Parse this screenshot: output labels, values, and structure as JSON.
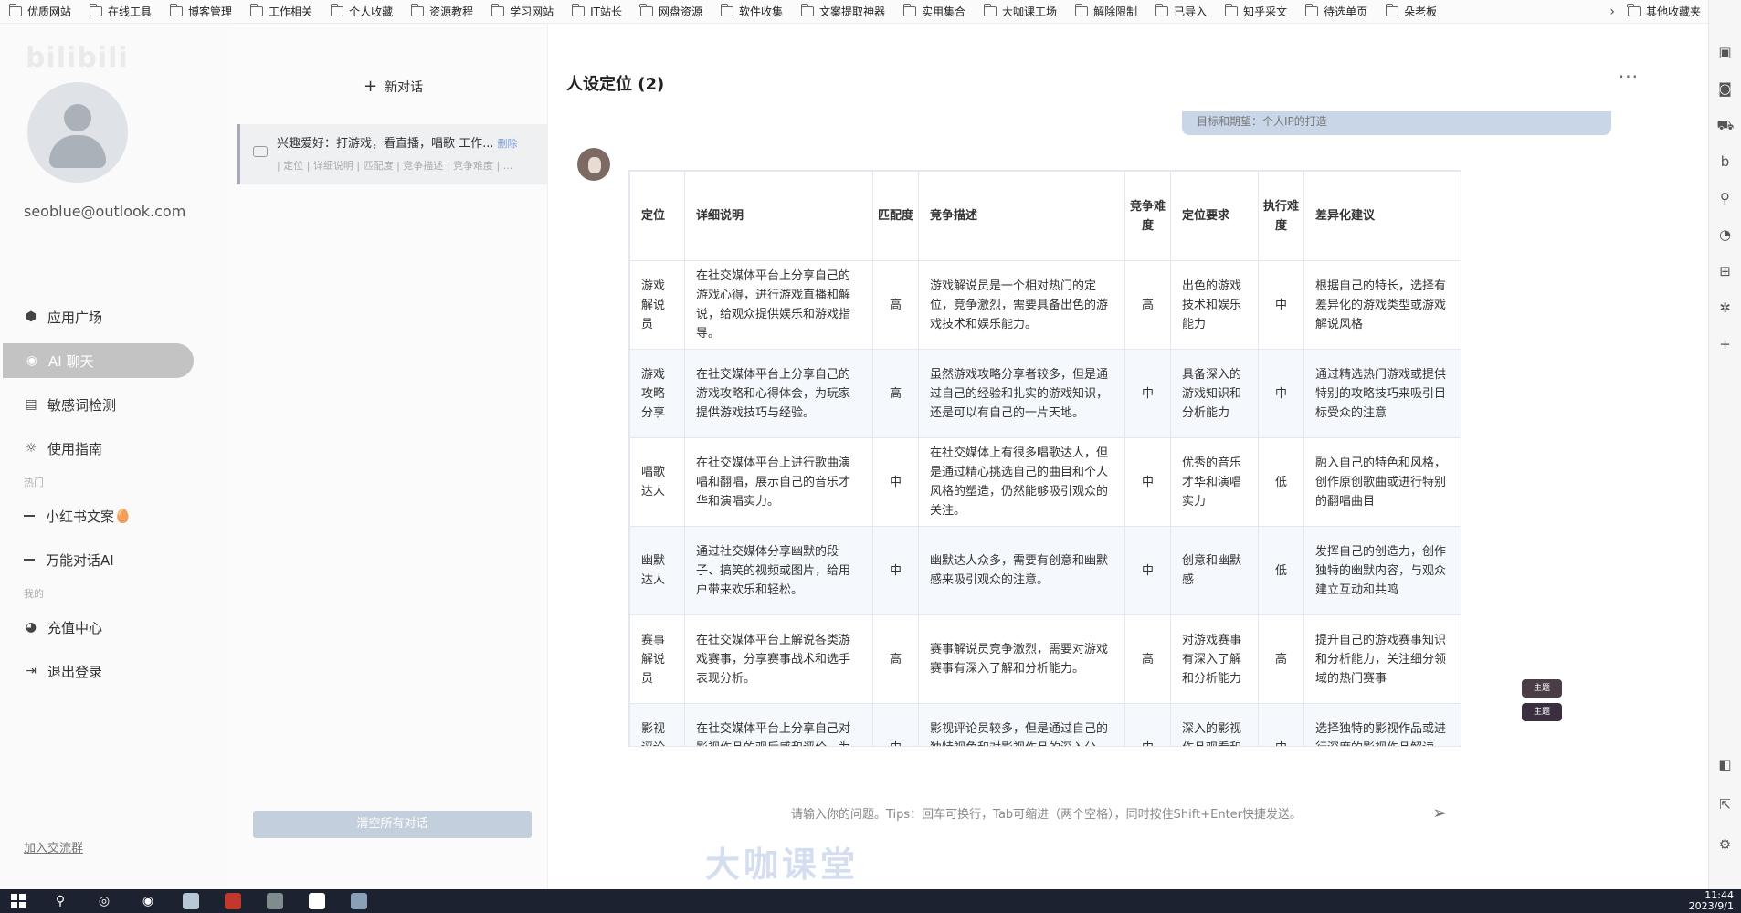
{
  "bookmarks": {
    "items": [
      "优质网站",
      "在线工具",
      "博客管理",
      "工作相关",
      "个人收藏",
      "资源教程",
      "学习网站",
      "IT站长",
      "网盘资源",
      "软件收集",
      "文案提取神器",
      "实用集合",
      "大咖课工场",
      "解除限制",
      "已导入",
      "知乎采文",
      "待选单页",
      "朵老板"
    ],
    "more": "›",
    "other": "其他收藏夹"
  },
  "sidebar": {
    "logo": "bilibili",
    "email": "seoblue@outlook.com",
    "nav": [
      {
        "label": "应用广场",
        "icon": "cube-icon"
      },
      {
        "label": "AI 聊天",
        "icon": "chat-bubble-icon"
      },
      {
        "label": "敏感词检测",
        "icon": "calendar-icon"
      },
      {
        "label": "使用指南",
        "icon": "sun-icon"
      }
    ],
    "section_hot": "热门",
    "hot": [
      {
        "label": "小红书文案",
        "emoji": "🥚"
      },
      {
        "label": "万能对话AI",
        "emoji": ""
      }
    ],
    "section_mine": "我的",
    "mine": [
      {
        "label": "充值中心",
        "icon": "user-circle-icon"
      },
      {
        "label": "退出登录",
        "icon": "logout-icon"
      }
    ],
    "join": "加入交流群"
  },
  "conversations": {
    "new_chat": "新对话",
    "items": [
      {
        "title": "兴趣爱好：打游戏，看直播，唱歌 工作...",
        "delete": "删除",
        "subtitle": "| 定位 | 详细说明 | 匹配度 | 竞争描述 | 竞争难度 | ..."
      }
    ],
    "clear_all": "清空所有对话"
  },
  "main": {
    "title": "人设定位 (2)",
    "more": "···",
    "prev_message": "目标和期望：个人IP的打造",
    "input_hint": "请输入你的问题。Tips：回车可换行，Tab可缩进（两个空格），同时按住Shift+Enter快捷发送。",
    "tag1": "主题",
    "tag2": "主题",
    "watermark": "大咖课堂"
  },
  "table": {
    "headers": [
      "定位",
      "详细说明",
      "匹配度",
      "竞争描述",
      "竞争难度",
      "定位要求",
      "执行难度",
      "差异化建议"
    ],
    "rows": [
      [
        "游戏解说员",
        "在社交媒体平台上分享自己的游戏心得，进行游戏直播和解说，给观众提供娱乐和游戏指导。",
        "高",
        "游戏解说员是一个相对热门的定位，竞争激烈，需要具备出色的游戏技术和娱乐能力。",
        "高",
        "出色的游戏技术和娱乐能力",
        "中",
        "根据自己的特长，选择有差异化的游戏类型或游戏解说风格"
      ],
      [
        "游戏攻略分享",
        "在社交媒体平台上分享自己的游戏攻略和心得体会，为玩家提供游戏技巧与经验。",
        "高",
        "虽然游戏攻略分享者较多，但是通过自己的经验和扎实的游戏知识，还是可以有自己的一片天地。",
        "中",
        "具备深入的游戏知识和分析能力",
        "中",
        "通过精选热门游戏或提供特别的攻略技巧来吸引目标受众的注意"
      ],
      [
        "唱歌达人",
        "在社交媒体平台上进行歌曲演唱和翻唱，展示自己的音乐才华和演唱实力。",
        "中",
        "在社交媒体上有很多唱歌达人，但是通过精心挑选自己的曲目和个人风格的塑造，仍然能够吸引观众的关注。",
        "中",
        "优秀的音乐才华和演唱实力",
        "低",
        "融入自己的特色和风格，创作原创歌曲或进行特别的翻唱曲目"
      ],
      [
        "幽默达人",
        "通过社交媒体分享幽默的段子、搞笑的视频或图片，给用户带来欢乐和轻松。",
        "中",
        "幽默达人众多，需要有创意和幽默感来吸引观众的注意。",
        "中",
        "创意和幽默感",
        "低",
        "发挥自己的创造力，创作独特的幽默内容，与观众建立互动和共鸣"
      ],
      [
        "赛事解说员",
        "在社交媒体平台上解说各类游戏赛事，分享赛事战术和选手表现分析。",
        "高",
        "赛事解说员竞争激烈，需要对游戏赛事有深入了解和分析能力。",
        "高",
        "对游戏赛事有深入了解和分析能力",
        "高",
        "提升自己的游戏赛事知识和分析能力，关注细分领域的热门赛事"
      ],
      [
        "影视评论员",
        "在社交媒体平台上分享自己对影视作品的观后感和评价，为观众提供影视推荐和评级。",
        "中",
        "影视评论员较多，但是通过自己的独特视角和对影视作品的深入分析，仍然可以吸引观众的关注。",
        "中",
        "深入的影视作品观看和分析能力",
        "中",
        "选择独特的影视作品或进行深度的影视作品解读，打造自己的品牌形象"
      ]
    ]
  },
  "taskbar": {
    "time": "11:44",
    "date": "2023/9/1"
  },
  "colors": {
    "active_nav": "#c3c3c3",
    "clear_button": "#c4cfdd",
    "taskbar": "#1c2230",
    "row_alt": "#f5f8fc",
    "tag": "#3b2f3f"
  }
}
